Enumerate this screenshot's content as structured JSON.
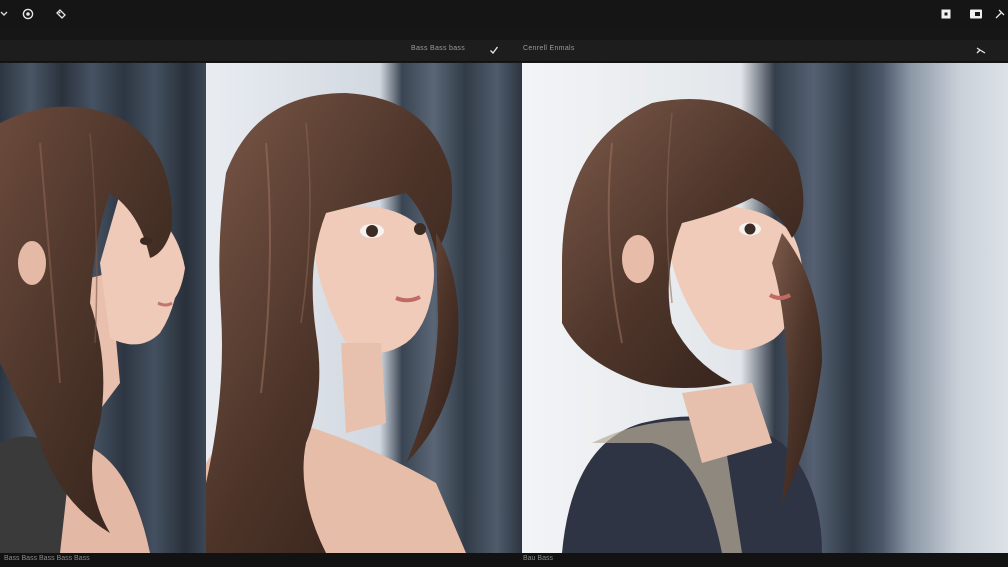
{
  "toolbar": {
    "left_icons": [
      "chevron-icon",
      "target-icon",
      "tag-icon"
    ],
    "right_icons": [
      "stop-icon",
      "record-icon",
      "pin-icon"
    ]
  },
  "panes": {
    "left_title": "Bass Bass bass",
    "right_title": "Cenrell Enmals"
  },
  "status": {
    "left_text": "Bass Bass Bass Bass Bass",
    "right_text": "Bau Bass"
  },
  "colors": {
    "background": "#161616",
    "curtain": "#3a4452",
    "hair": "#4a3328",
    "skin": "#e9c2b0",
    "top": "#2f3444"
  }
}
